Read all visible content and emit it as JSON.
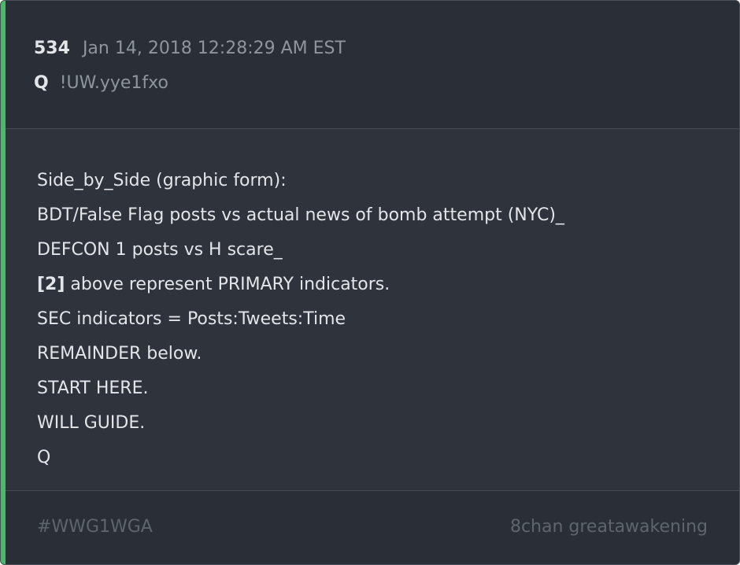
{
  "post": {
    "number": "534",
    "date": "Jan 14, 2018 12:28:29 AM EST",
    "author": "Q",
    "tripcode": "!UW.yye1fxo"
  },
  "body": {
    "lines": [
      {
        "prefix": "",
        "text": "Side_by_Side (graphic form):"
      },
      {
        "prefix": "",
        "text": "BDT/False Flag posts vs actual news of bomb attempt (NYC)_"
      },
      {
        "prefix": "",
        "text": "DEFCON 1 posts vs H scare_"
      },
      {
        "prefix": "[2]",
        "text": " above represent PRIMARY indicators."
      },
      {
        "prefix": "",
        "text": "SEC indicators = Posts:Tweets:Time"
      },
      {
        "prefix": "",
        "text": "REMAINDER below."
      },
      {
        "prefix": "",
        "text": "START HERE."
      },
      {
        "prefix": "",
        "text": "WILL GUIDE."
      },
      {
        "prefix": "",
        "text": "Q"
      }
    ]
  },
  "footer": {
    "hashtag": "#WWG1WGA",
    "board": "8chan greatawakening"
  },
  "colors": {
    "accent": "#4db869",
    "card_background": "#2e333c",
    "header_background": "#2a2f37",
    "text_primary": "#e3e5e8",
    "text_muted": "#8f959e"
  }
}
